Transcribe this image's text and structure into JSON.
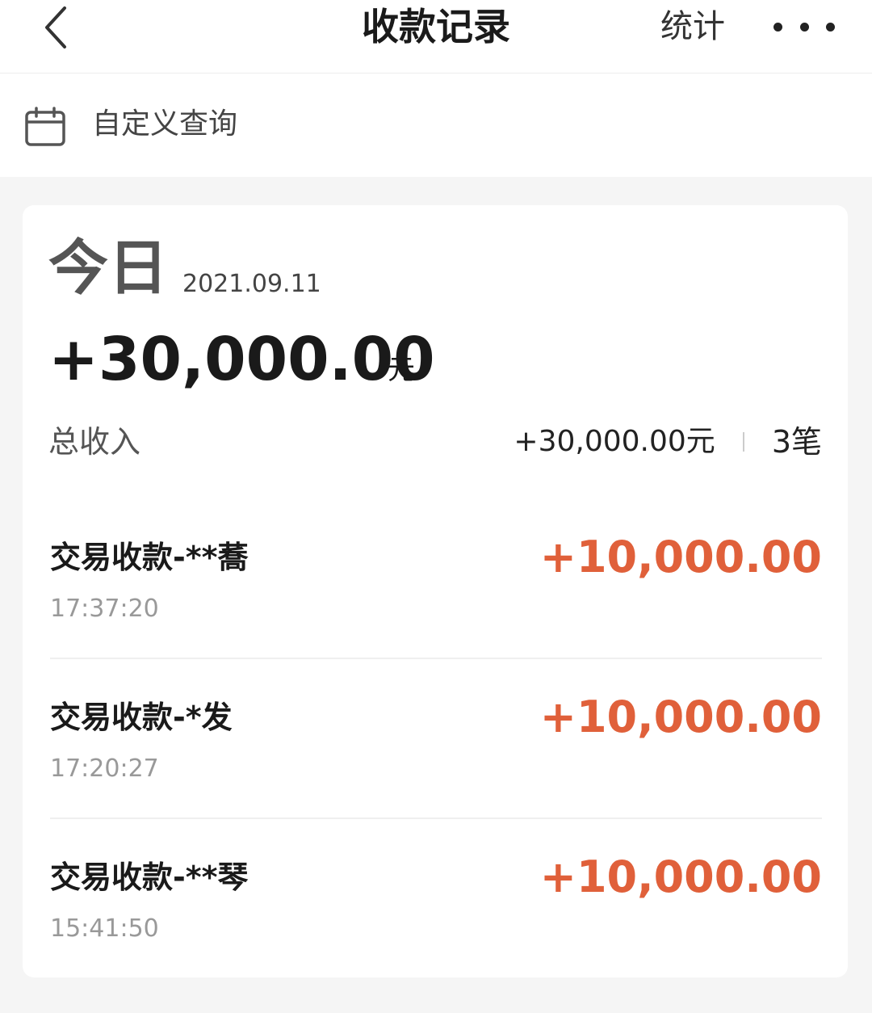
{
  "nav": {
    "title": "收款记录",
    "stats_label": "统计"
  },
  "query": {
    "label": "自定义查询"
  },
  "summary": {
    "day_label": "今日",
    "date": "2021.09.11",
    "total_amount": "+30,000.00",
    "unit": "元",
    "income_label": "总收入",
    "income_total": "+30,000.00元",
    "count": "3笔"
  },
  "transactions": [
    {
      "name": "交易收款-**蕎",
      "time": "17:37:20",
      "amount": "+10,000.00"
    },
    {
      "name": "交易收款-*发",
      "time": "17:20:27",
      "amount": "+10,000.00"
    },
    {
      "name": "交易收款-**琴",
      "time": "15:41:50",
      "amount": "+10,000.00"
    }
  ],
  "colors": {
    "accent": "#e0603a",
    "text_primary": "#1a1a1a",
    "text_secondary": "#999999",
    "background": "#f5f5f5"
  },
  "icons": {
    "back": "chevron-left-icon",
    "more": "more-dots-icon",
    "calendar": "calendar-icon"
  }
}
